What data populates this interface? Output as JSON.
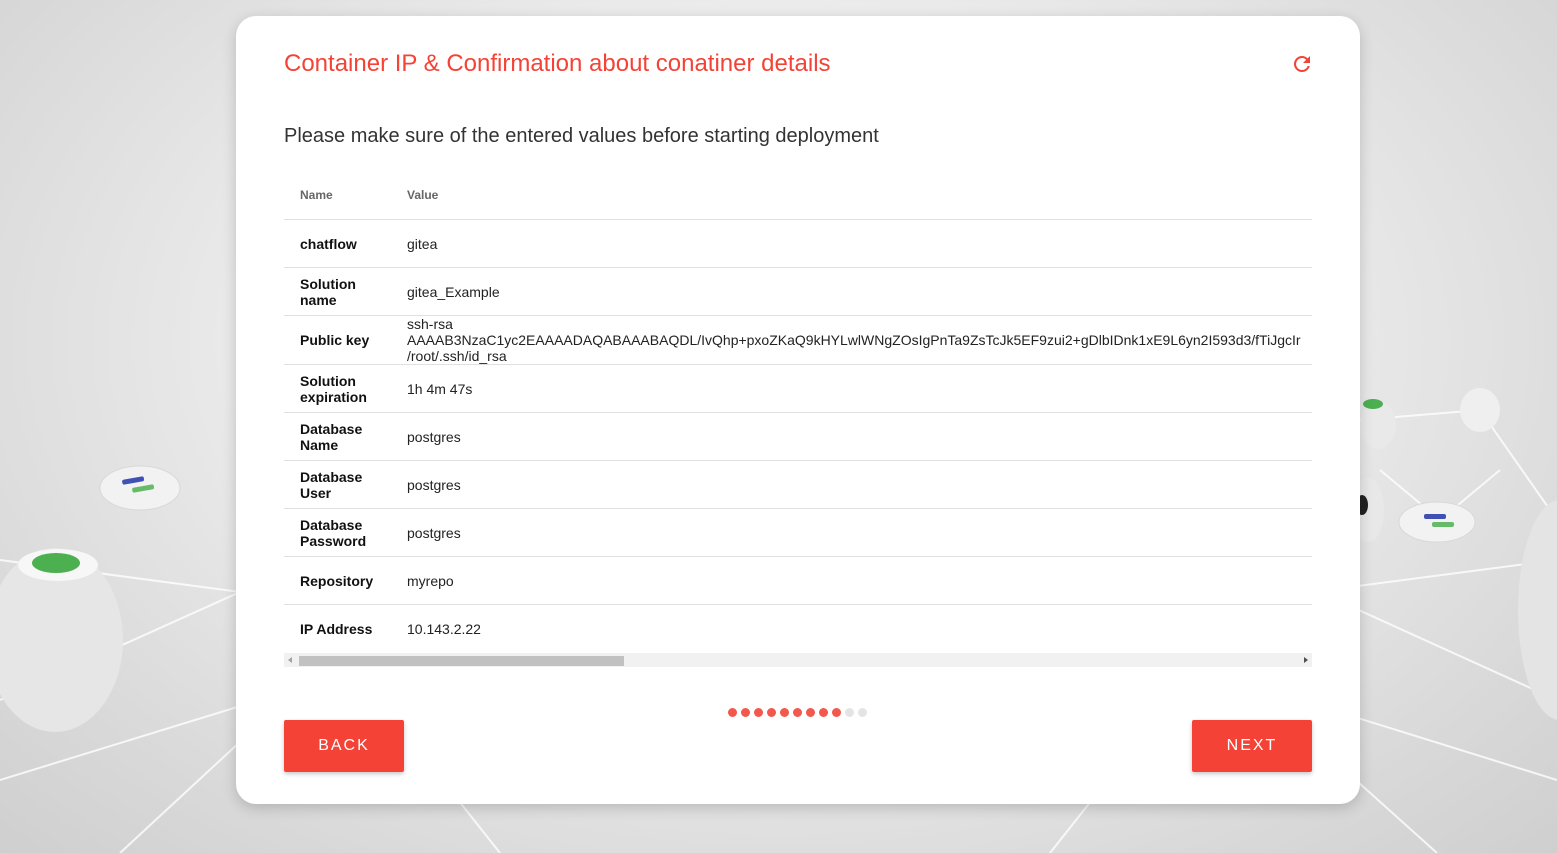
{
  "dialog": {
    "title": "Container IP & Confirmation about conatiner details",
    "subtitle": "Please make sure of the entered values before starting deployment"
  },
  "table": {
    "headers": {
      "name": "Name",
      "value": "Value"
    },
    "rows": [
      {
        "name": "chatflow",
        "value": [
          "gitea"
        ]
      },
      {
        "name": "Solution name",
        "value": [
          "gitea_Example"
        ]
      },
      {
        "name": "Public key",
        "value": [
          "ssh-rsa",
          "AAAAB3NzaC1yc2EAAAADAQABAAABAQDL/IvQhp+pxoZKaQ9kHYLwlWNgZOsIgPnTa9ZsTcJk5EF9zui2+gDlbIDnk1xE9L6yn2I593d3/fTiJgcIr",
          "/root/.ssh/id_rsa"
        ]
      },
      {
        "name": "Solution expiration",
        "value": [
          "1h 4m 47s"
        ]
      },
      {
        "name": "Database Name",
        "value": [
          "postgres"
        ]
      },
      {
        "name": "Database User",
        "value": [
          "postgres"
        ]
      },
      {
        "name": "Database Password",
        "value": [
          "postgres"
        ]
      },
      {
        "name": "Repository",
        "value": [
          "myrepo"
        ]
      },
      {
        "name": "IP Address",
        "value": [
          "10.143.2.22"
        ]
      }
    ]
  },
  "progress": {
    "total_steps": 11,
    "completed_steps": 9,
    "active_color": "#f4574c",
    "inactive_color": "#e4e4e4"
  },
  "buttons": {
    "back": "BACK",
    "next": "NEXT"
  },
  "icons": {
    "refresh": "refresh-icon"
  },
  "colors": {
    "accent": "#f44336"
  }
}
